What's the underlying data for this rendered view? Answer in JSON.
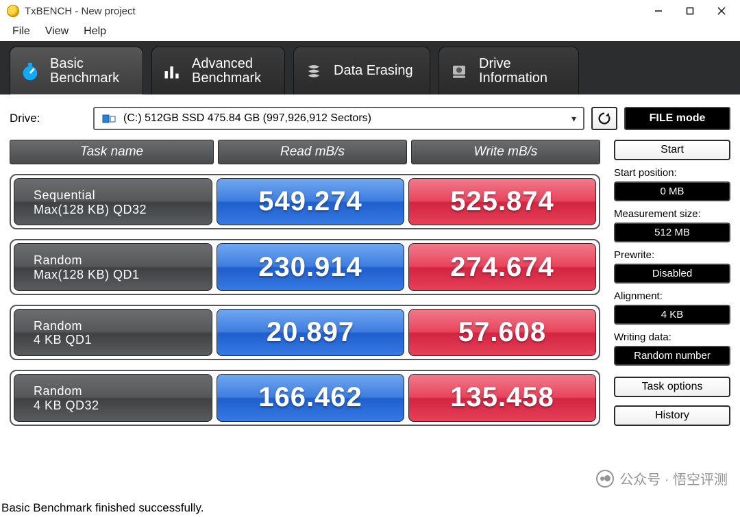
{
  "window": {
    "title": "TxBENCH - New project"
  },
  "menubar": [
    "File",
    "View",
    "Help"
  ],
  "tabs": [
    {
      "line1": "Basic",
      "line2": "Benchmark",
      "icon": "stopwatch"
    },
    {
      "line1": "Advanced",
      "line2": "Benchmark",
      "icon": "bars"
    },
    {
      "line1": "Data Erasing",
      "line2": "",
      "icon": "erase"
    },
    {
      "line1": "Drive",
      "line2": "Information",
      "icon": "drive"
    }
  ],
  "drive": {
    "label": "Drive:",
    "selected": "(C:) 512GB SSD  475.84 GB (997,926,912 Sectors)",
    "filemode": "FILE mode"
  },
  "headers": {
    "task": "Task name",
    "read": "Read mB/s",
    "write": "Write mB/s"
  },
  "rows": [
    {
      "name1": "Sequential",
      "name2": "Max(128 KB) QD32",
      "read": "549.274",
      "write": "525.874"
    },
    {
      "name1": "Random",
      "name2": "Max(128 KB) QD1",
      "read": "230.914",
      "write": "274.674"
    },
    {
      "name1": "Random",
      "name2": "4 KB QD1",
      "read": "20.897",
      "write": "57.608"
    },
    {
      "name1": "Random",
      "name2": "4 KB QD32",
      "read": "166.462",
      "write": "135.458"
    }
  ],
  "side": {
    "start": "Start",
    "startpos_label": "Start position:",
    "startpos": "0 MB",
    "meassize_label": "Measurement size:",
    "meassize": "512 MB",
    "prewrite_label": "Prewrite:",
    "prewrite": "Disabled",
    "align_label": "Alignment:",
    "align": "4 KB",
    "wdata_label": "Writing data:",
    "wdata": "Random number",
    "taskopt": "Task options",
    "history": "History"
  },
  "status": "Basic Benchmark finished successfully.",
  "watermark": "公众号 · 悟空评测",
  "chart_data": {
    "type": "table",
    "title": "TxBENCH Basic Benchmark",
    "columns": [
      "Task name",
      "Read mB/s",
      "Write mB/s"
    ],
    "rows": [
      [
        "Sequential Max(128 KB) QD32",
        549.274,
        525.874
      ],
      [
        "Random Max(128 KB) QD1",
        230.914,
        274.674
      ],
      [
        "Random 4 KB QD1",
        20.897,
        57.608
      ],
      [
        "Random 4 KB QD32",
        166.462,
        135.458
      ]
    ]
  }
}
